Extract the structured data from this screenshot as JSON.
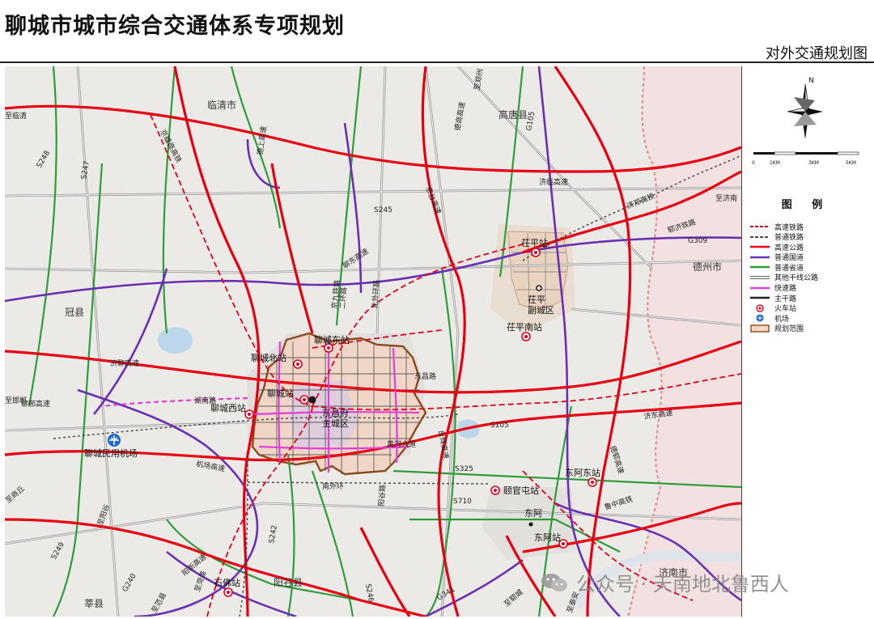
{
  "header": {
    "title": "聊城市城市综合交通体系专项规划",
    "subtitle": "对外交通规划图"
  },
  "compass": {
    "north_label": "N"
  },
  "scale_bar": {
    "labels": [
      "0",
      "1KM",
      "3KM",
      "5KM"
    ]
  },
  "legend": {
    "title": "图 例",
    "items": [
      {
        "label": "高速铁路",
        "symbol": "dashed-line",
        "color": "#e0001a"
      },
      {
        "label": "普通铁路",
        "symbol": "dashed-line",
        "color": "#444444"
      },
      {
        "label": "高速公路",
        "symbol": "line",
        "color": "#e60012"
      },
      {
        "label": "普通国道",
        "symbol": "line",
        "color": "#6a2fb2"
      },
      {
        "label": "普通省道",
        "symbol": "line",
        "color": "#2e9c3b"
      },
      {
        "label": "其他干线公路",
        "symbol": "double-line",
        "color": "#666666"
      },
      {
        "label": "快速路",
        "symbol": "line",
        "color": "#e040d8"
      },
      {
        "label": "主干路",
        "symbol": "line",
        "color": "#222222"
      },
      {
        "label": "火车站",
        "symbol": "station-icon",
        "color": "#e0001a"
      },
      {
        "label": "机场",
        "symbol": "airport-icon",
        "color": "#1a66d9"
      },
      {
        "label": "规划范围",
        "symbol": "boundary",
        "color": "#8b4a1c"
      }
    ]
  },
  "map": {
    "regions": [
      "临清市",
      "高唐县",
      "德州市",
      "冠县",
      "阳谷县",
      "莘县",
      "济南市"
    ],
    "districts": [
      {
        "name": "东昌府\n主城区"
      },
      {
        "name": "茌平\n副城区"
      },
      {
        "name": "东阿"
      }
    ],
    "stations": [
      "聊城东站",
      "聊城北站",
      "聊城站",
      "聊城西站",
      "茌平站",
      "茌平南站",
      "颐官屯站",
      "东阿东站",
      "东阿站",
      "石佛站"
    ],
    "airport": "聊城民用机场",
    "road_labels": [
      "济聊高速",
      "济临高速",
      "济郑高铁",
      "机场高速",
      "济东高速",
      "聊邢高速",
      "德上高速",
      "京雄商高铁",
      "德郓高速",
      "郓济铁路",
      "聊东高速",
      "鲁中高铁",
      "台辉高速",
      "京台高速",
      "德商高速",
      "阳新高速",
      "京九铁路",
      "G309",
      "G240",
      "G105",
      "G341",
      "S245",
      "S246",
      "S247",
      "S248",
      "S249",
      "S242",
      "S325",
      "S710",
      "S105",
      "至临清",
      "至济南",
      "至邯郸",
      "至菏泽",
      "至郓城",
      "至范县",
      "至阳谷",
      "至泰安",
      "至商丘",
      "至郑州",
      "二环路",
      "东昌路",
      "北外环路",
      "南外环",
      "黄河大道",
      "湖南路",
      "阳谷路"
    ],
    "color_expressway": "#e60012",
    "color_national": "#6a2fb2",
    "color_provincial": "#2e9c3b",
    "color_fastroad": "#e040d8",
    "color_boundary": "#8b4a1c"
  },
  "watermark": {
    "text": "公众号 · 天南地北鲁西人"
  }
}
